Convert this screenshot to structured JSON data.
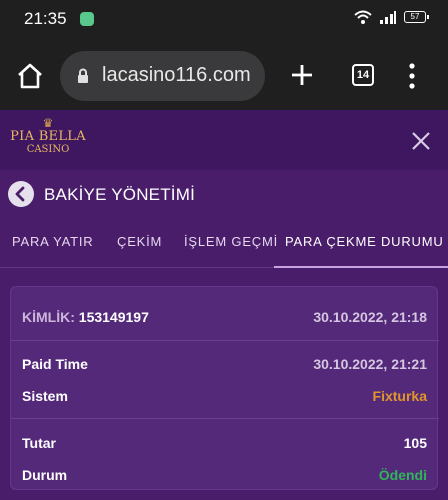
{
  "status_bar": {
    "time": "21:35",
    "battery": "57",
    "icons": [
      "wifi-icon",
      "signal-icon",
      "battery-icon"
    ]
  },
  "browser": {
    "url": "lacasino116.com",
    "tab_count": "14"
  },
  "brand": {
    "logo_name": "PIA BELLA",
    "logo_sub": "CASINO",
    "gold": "#e8b860"
  },
  "page": {
    "title": "BAKİYE YÖNETİMİ"
  },
  "tabs": [
    {
      "label": "PARA YATIR",
      "active": false
    },
    {
      "label": "ÇEKİM",
      "active": false
    },
    {
      "label": "İŞLEM GEÇMİ",
      "active": false
    },
    {
      "label": "PARA ÇEKME DURUMU",
      "active": true
    }
  ],
  "withdrawal": {
    "id_label": "KİMLİK:",
    "id_value": "153149197",
    "created": "30.10.2022, 21:18",
    "rows": [
      {
        "label": "Paid Time",
        "value": "30.10.2022, 21:21"
      },
      {
        "label": "Sistem",
        "value": "Fixturka"
      },
      {
        "label": "Tutar",
        "value": "105"
      },
      {
        "label": "Durum",
        "value": "Ödendi"
      }
    ]
  },
  "colors": {
    "background": "#4a1d6b",
    "header": "#3f1760",
    "card": "#55297a",
    "system_value": "#e0962a",
    "status_paid": "#2fb55a"
  }
}
